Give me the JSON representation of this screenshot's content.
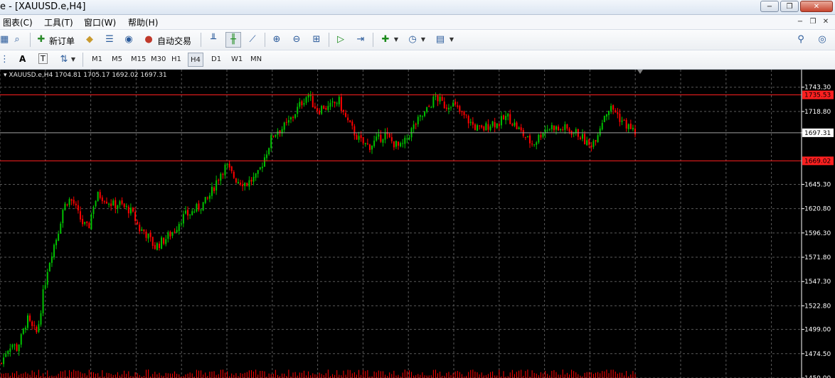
{
  "window": {
    "title": "e - [XAUUSD.e,H4]",
    "controls": {
      "minimize": "−",
      "restore": "❐",
      "close": "✕"
    }
  },
  "menu": {
    "items": [
      "图表(C)",
      "工具(T)",
      "窗口(W)",
      "帮助(H)"
    ],
    "mdi_controls": [
      "−",
      "❐",
      "✕"
    ]
  },
  "toolbar1": {
    "new_order": "新订单",
    "auto_trading": "自动交易",
    "icons": [
      "chart-icon",
      "zoom-chart-icon",
      "new-order-icon",
      "market-watch-icon",
      "navigator-icon",
      "signal-icon",
      "auto-trading-icon",
      "bar-chart-icon",
      "candles-icon",
      "line-chart-icon",
      "zoom-in-icon",
      "zoom-out-icon",
      "tile-icon",
      "autoscroll-icon",
      "chart-shift-icon",
      "indicators-icon",
      "periods-icon",
      "templates-icon"
    ]
  },
  "toolbar2": {
    "timeframes": [
      "M1",
      "M5",
      "M15",
      "M30",
      "H1",
      "H4",
      "D1",
      "W1",
      "MN"
    ],
    "active_timeframe": "H4",
    "text_tool": "A",
    "label_tool": "T"
  },
  "chart": {
    "symbol_line": "XAUUSD.e,H4  1704.81 1705.17 1692.02 1697.31",
    "colors": {
      "background": "#000000",
      "bull": "#00c000",
      "bear": "#ff0000",
      "grid": "#5a5a5a",
      "hline": "#ff2020"
    }
  },
  "chart_data": {
    "type": "candlestick",
    "symbol": "XAUUSD.e",
    "timeframe": "H4",
    "ohlc": {
      "open": 1704.81,
      "high": 1705.17,
      "low": 1692.02,
      "close": 1697.31
    },
    "current_price": 1697.31,
    "price_labels": [
      1743.3,
      1718.8,
      1697.31,
      1645.3,
      1620.8,
      1596.3,
      1571.8,
      1547.3,
      1522.8,
      1499.0,
      1474.5,
      1450.0
    ],
    "ylim": [
      1450.0,
      1761.0
    ],
    "horizontal_lines": [
      1735.53,
      1669.02
    ],
    "close_path": [
      1465,
      1478,
      1485,
      1480,
      1492,
      1510,
      1500,
      1495,
      1530,
      1560,
      1580,
      1595,
      1620,
      1630,
      1628,
      1615,
      1605,
      1600,
      1625,
      1635,
      1632,
      1628,
      1624,
      1626,
      1622,
      1620,
      1612,
      1600,
      1598,
      1590,
      1582,
      1586,
      1590,
      1595,
      1600,
      1610,
      1614,
      1616,
      1620,
      1624,
      1628,
      1636,
      1648,
      1658,
      1664,
      1656,
      1650,
      1648,
      1646,
      1650,
      1652,
      1666,
      1680,
      1694,
      1700,
      1702,
      1706,
      1714,
      1722,
      1730,
      1736,
      1726,
      1720,
      1724,
      1722,
      1726,
      1730,
      1716,
      1706,
      1698,
      1690,
      1686,
      1684,
      1688,
      1692,
      1696,
      1690,
      1686,
      1682,
      1688,
      1698,
      1706,
      1712,
      1718,
      1726,
      1734,
      1728,
      1724,
      1728,
      1722,
      1716,
      1712,
      1706,
      1702,
      1700,
      1704,
      1708,
      1706,
      1710,
      1714,
      1708,
      1702,
      1696,
      1690,
      1686,
      1692,
      1700,
      1702,
      1704,
      1700,
      1702,
      1700,
      1698,
      1696,
      1690,
      1684,
      1690,
      1702,
      1716,
      1722,
      1720,
      1712,
      1706,
      1702,
      1698
    ]
  }
}
